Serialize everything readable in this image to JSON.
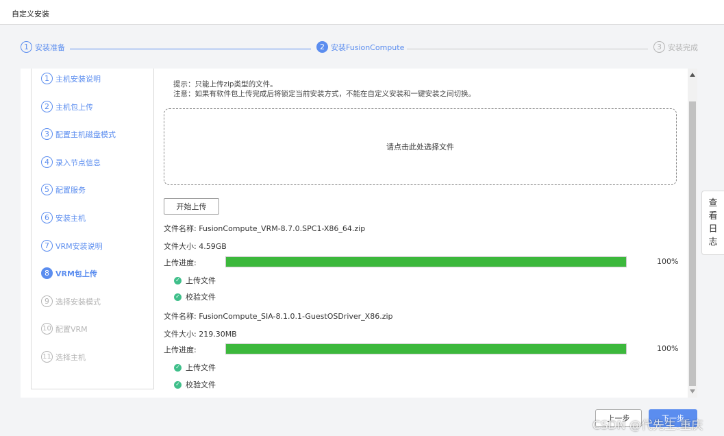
{
  "window": {
    "title": "自定义安装"
  },
  "stepper": {
    "steps": [
      {
        "num": "1",
        "label": "安装准备",
        "state": "done"
      },
      {
        "num": "2",
        "label": "安装FusionCompute",
        "state": "active"
      },
      {
        "num": "3",
        "label": "安装完成",
        "state": "pending"
      }
    ]
  },
  "sidebar": {
    "items": [
      {
        "num": "1",
        "label": "主机安装说明",
        "state": "done"
      },
      {
        "num": "2",
        "label": "主机包上传",
        "state": "done"
      },
      {
        "num": "3",
        "label": "配置主机磁盘模式",
        "state": "done"
      },
      {
        "num": "4",
        "label": "录入节点信息",
        "state": "done"
      },
      {
        "num": "5",
        "label": "配置服务",
        "state": "done"
      },
      {
        "num": "6",
        "label": "安装主机",
        "state": "done"
      },
      {
        "num": "7",
        "label": "VRM安装说明",
        "state": "done"
      },
      {
        "num": "8",
        "label": "VRM包上传",
        "state": "active"
      },
      {
        "num": "9",
        "label": "选择安装模式",
        "state": "pending"
      },
      {
        "num": "10",
        "label": "配置VRM",
        "state": "pending"
      },
      {
        "num": "11",
        "label": "选择主机",
        "state": "pending"
      }
    ]
  },
  "content": {
    "hint_line1": "提示：只能上传zip类型的文件。",
    "hint_line2": "注意：如果有软件包上传完成后将锁定当前安装方式，不能在自定义安装和一键安装之间切换。",
    "dropzone_text": "请点击此处选择文件",
    "start_upload_label": "开始上传",
    "files": [
      {
        "name_line": "文件名称: FusionCompute_VRM-8.7.0.SPC1-X86_64.zip",
        "size_line": "文件大小: 4.59GB",
        "progress_label": "上传进度:",
        "progress_value": 1.0,
        "progress_text": "100%",
        "checks": [
          "上传文件",
          "校验文件"
        ]
      },
      {
        "name_line": "文件名称: FusionCompute_SIA-8.1.0.1-GuestOSDriver_X86.zip",
        "size_line": "文件大小: 219.30MB",
        "progress_label": "上传进度:",
        "progress_value": 1.0,
        "progress_text": "100%",
        "checks": [
          "上传文件",
          "校验文件"
        ]
      }
    ]
  },
  "log_tab": {
    "chars": [
      "查",
      "看",
      "日",
      "志"
    ]
  },
  "footer": {
    "prev_label": "上一步",
    "next_label": "下一步"
  },
  "watermark": "CSDN @代先生.重庆",
  "colors": {
    "accent": "#5b8def",
    "progress": "#3cb83c",
    "check": "#3fbf8a",
    "pending": "#b5b5b5"
  },
  "icons": {
    "check": "check-circle-icon",
    "scroll_up": "scroll-up-arrow-icon",
    "scroll_down": "scroll-down-arrow-icon"
  }
}
